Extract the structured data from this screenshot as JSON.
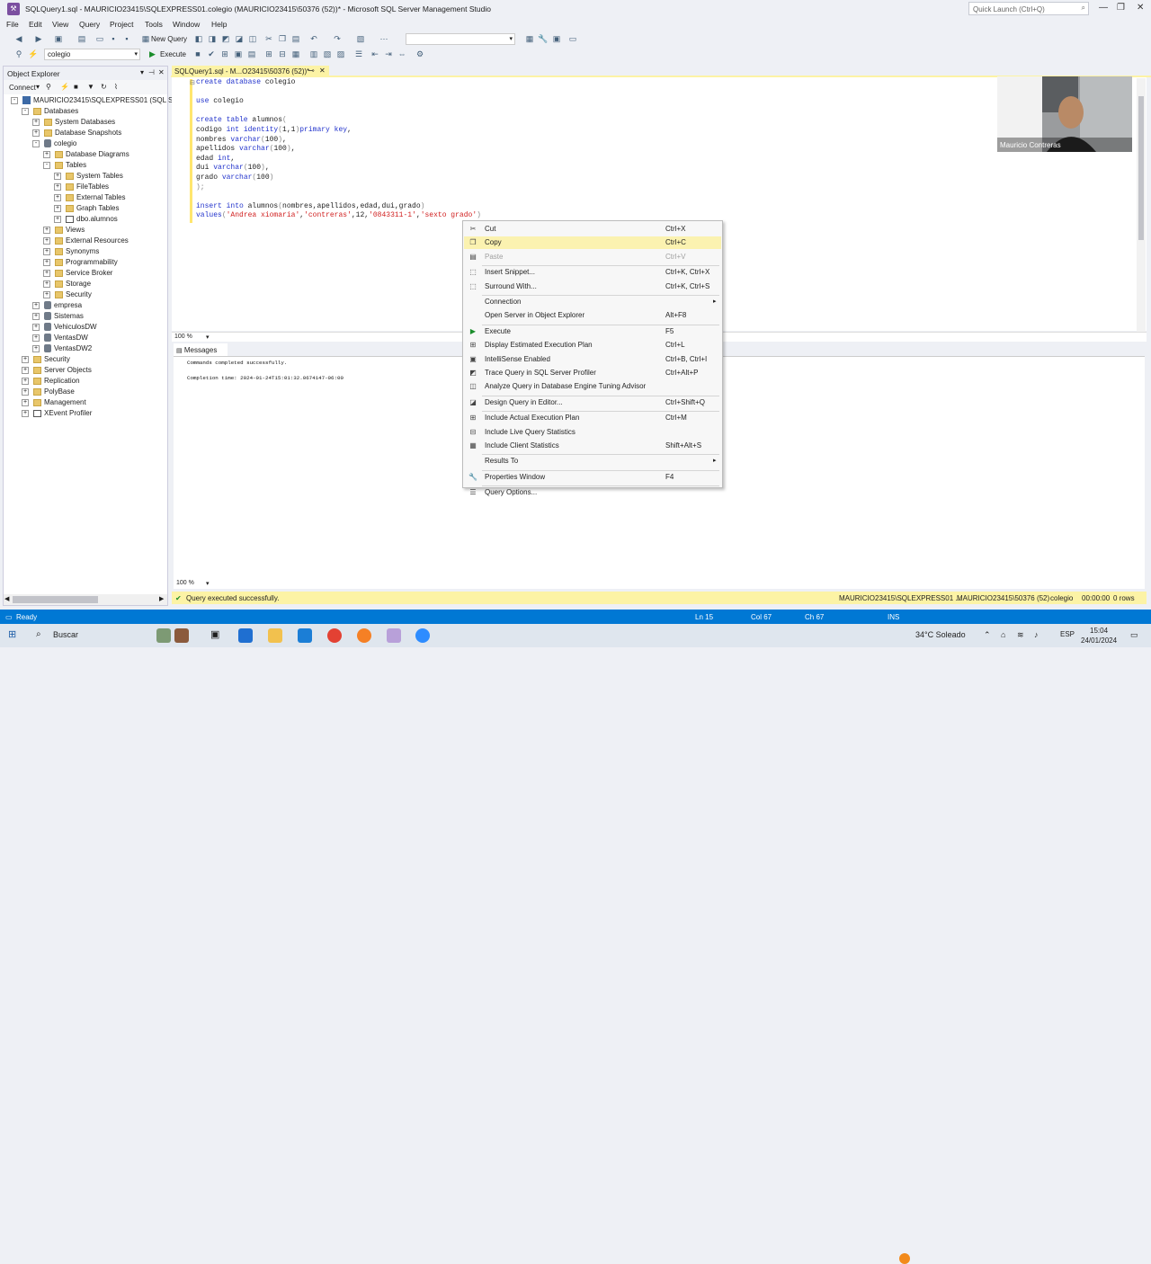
{
  "window": {
    "title": "SQLQuery1.sql - MAURICIO23415\\SQLEXPRESS01.colegio (MAURICIO23415\\50376 (52))* - Microsoft SQL Server Management Studio",
    "quick_launch_placeholder": "Quick Launch (Ctrl+Q)"
  },
  "menu": [
    "File",
    "Edit",
    "View",
    "Query",
    "Project",
    "Tools",
    "Window",
    "Help"
  ],
  "toolbar": {
    "new_query": "New Query",
    "execute": "Execute",
    "database": "colegio"
  },
  "object_explorer": {
    "title": "Object Explorer",
    "connect": "Connect",
    "server": "MAURICIO23415\\SQLEXPRESS01 (SQL Server",
    "tree": [
      {
        "label": "MAURICIO23415\\SQLEXPRESS01 (SQL Serve",
        "level": 0,
        "icon": "server",
        "exp": "-"
      },
      {
        "label": "Databases",
        "level": 1,
        "icon": "folder",
        "exp": "-"
      },
      {
        "label": "System Databases",
        "level": 2,
        "icon": "folder",
        "exp": "+"
      },
      {
        "label": "Database Snapshots",
        "level": 2,
        "icon": "folder",
        "exp": "+"
      },
      {
        "label": "colegio",
        "level": 2,
        "icon": "db",
        "exp": "-"
      },
      {
        "label": "Database Diagrams",
        "level": 3,
        "icon": "folder",
        "exp": "+"
      },
      {
        "label": "Tables",
        "level": 3,
        "icon": "folder",
        "exp": "-"
      },
      {
        "label": "System Tables",
        "level": 4,
        "icon": "folder",
        "exp": "+"
      },
      {
        "label": "FileTables",
        "level": 4,
        "icon": "folder",
        "exp": "+"
      },
      {
        "label": "External Tables",
        "level": 4,
        "icon": "folder",
        "exp": "+"
      },
      {
        "label": "Graph Tables",
        "level": 4,
        "icon": "folder",
        "exp": "+"
      },
      {
        "label": "dbo.alumnos",
        "level": 4,
        "icon": "table",
        "exp": "+"
      },
      {
        "label": "Views",
        "level": 3,
        "icon": "folder",
        "exp": "+"
      },
      {
        "label": "External Resources",
        "level": 3,
        "icon": "folder",
        "exp": "+"
      },
      {
        "label": "Synonyms",
        "level": 3,
        "icon": "folder",
        "exp": "+"
      },
      {
        "label": "Programmability",
        "level": 3,
        "icon": "folder",
        "exp": "+"
      },
      {
        "label": "Service Broker",
        "level": 3,
        "icon": "folder",
        "exp": "+"
      },
      {
        "label": "Storage",
        "level": 3,
        "icon": "folder",
        "exp": "+"
      },
      {
        "label": "Security",
        "level": 3,
        "icon": "folder",
        "exp": "+"
      },
      {
        "label": "empresa",
        "level": 2,
        "icon": "db",
        "exp": "+"
      },
      {
        "label": "Sistemas",
        "level": 2,
        "icon": "db",
        "exp": "+"
      },
      {
        "label": "VehiculosDW",
        "level": 2,
        "icon": "db",
        "exp": "+"
      },
      {
        "label": "VentasDW",
        "level": 2,
        "icon": "db",
        "exp": "+"
      },
      {
        "label": "VentasDW2",
        "level": 2,
        "icon": "db",
        "exp": "+"
      },
      {
        "label": "Security",
        "level": 1,
        "icon": "folder",
        "exp": "+"
      },
      {
        "label": "Server Objects",
        "level": 1,
        "icon": "folder",
        "exp": "+"
      },
      {
        "label": "Replication",
        "level": 1,
        "icon": "folder",
        "exp": "+"
      },
      {
        "label": "PolyBase",
        "level": 1,
        "icon": "folder",
        "exp": "+"
      },
      {
        "label": "Management",
        "level": 1,
        "icon": "folder",
        "exp": "+"
      },
      {
        "label": "XEvent Profiler",
        "level": 1,
        "icon": "xevent",
        "exp": "+"
      }
    ]
  },
  "editor": {
    "tab_label": "SQLQuery1.sql - M...O23415\\50376 (52))*",
    "zoom": "100 %"
  },
  "results": {
    "tab": "Messages",
    "line1": "Commands completed successfully.",
    "line2": "Completion time: 2024-01-24T15:01:32.0674147-06:00",
    "zoom": "100 %"
  },
  "query_status": {
    "message": "Query executed successfully.",
    "server": "MAURICIO23415\\SQLEXPRESS01 ...",
    "user": "MAURICIO23415\\50376 (52)",
    "database": "colegio",
    "time": "00:00:00",
    "rows": "0 rows"
  },
  "app_status": {
    "ready": "Ready",
    "ln": "Ln 15",
    "col": "Col 67",
    "ch": "Ch 67",
    "ins": "INS"
  },
  "context_menu": [
    {
      "label": "Cut",
      "shortcut": "Ctrl+X",
      "icon": "cut-icon",
      "glyph": "✂"
    },
    {
      "label": "Copy",
      "shortcut": "Ctrl+C",
      "icon": "copy-icon",
      "glyph": "❐",
      "highlight": true
    },
    {
      "label": "Paste",
      "shortcut": "Ctrl+V",
      "icon": "paste-icon",
      "glyph": "▤",
      "disabled": true
    },
    {
      "sep": true
    },
    {
      "label": "Insert Snippet...",
      "shortcut": "Ctrl+K, Ctrl+X",
      "icon": "snippet-icon",
      "glyph": "⬚"
    },
    {
      "label": "Surround With...",
      "shortcut": "Ctrl+K, Ctrl+S",
      "icon": "surround-icon",
      "glyph": "⬚"
    },
    {
      "sep": true
    },
    {
      "label": "Connection",
      "shortcut": "",
      "submenu": true
    },
    {
      "label": "Open Server in Object Explorer",
      "shortcut": "Alt+F8"
    },
    {
      "sep": true
    },
    {
      "label": "Execute",
      "shortcut": "F5",
      "icon": "execute-icon",
      "glyph": "▶"
    },
    {
      "label": "Display Estimated Execution Plan",
      "shortcut": "Ctrl+L",
      "icon": "plan-icon",
      "glyph": "⊞"
    },
    {
      "label": "IntelliSense Enabled",
      "shortcut": "Ctrl+B, Ctrl+I",
      "icon": "intellisense-icon",
      "glyph": "▣"
    },
    {
      "label": "Trace Query in SQL Server Profiler",
      "shortcut": "Ctrl+Alt+P",
      "icon": "profiler-icon",
      "glyph": "◩"
    },
    {
      "label": "Analyze Query in Database Engine Tuning Advisor",
      "shortcut": "",
      "icon": "tuning-icon",
      "glyph": "◫"
    },
    {
      "sep": true
    },
    {
      "label": "Design Query in Editor...",
      "shortcut": "Ctrl+Shift+Q",
      "icon": "design-icon",
      "glyph": "◪"
    },
    {
      "sep": true
    },
    {
      "label": "Include Actual Execution Plan",
      "shortcut": "Ctrl+M",
      "icon": "actual-plan-icon",
      "glyph": "⊞"
    },
    {
      "label": "Include Live Query Statistics",
      "shortcut": "",
      "icon": "live-stats-icon",
      "glyph": "⊟"
    },
    {
      "label": "Include Client Statistics",
      "shortcut": "Shift+Alt+S",
      "icon": "client-stats-icon",
      "glyph": "▦"
    },
    {
      "sep": true
    },
    {
      "label": "Results To",
      "shortcut": "",
      "submenu": true
    },
    {
      "sep": true
    },
    {
      "label": "Properties Window",
      "shortcut": "F4",
      "icon": "wrench-icon",
      "glyph": "🔧"
    },
    {
      "sep": true
    },
    {
      "label": "Query Options...",
      "shortcut": "",
      "icon": "options-icon",
      "glyph": "☰"
    }
  ],
  "webcam": {
    "name": "Mauricio Contreras"
  },
  "taskbar": {
    "search": "Buscar",
    "weather": "34°C  Soleado",
    "lang": "ESP",
    "time": "15:04",
    "date": "24/01/2024"
  },
  "colors": {
    "accent": "#0078d4",
    "doc_tab": "#fcf3a5",
    "keyword": "#2233cc",
    "string": "#d01e1e"
  }
}
